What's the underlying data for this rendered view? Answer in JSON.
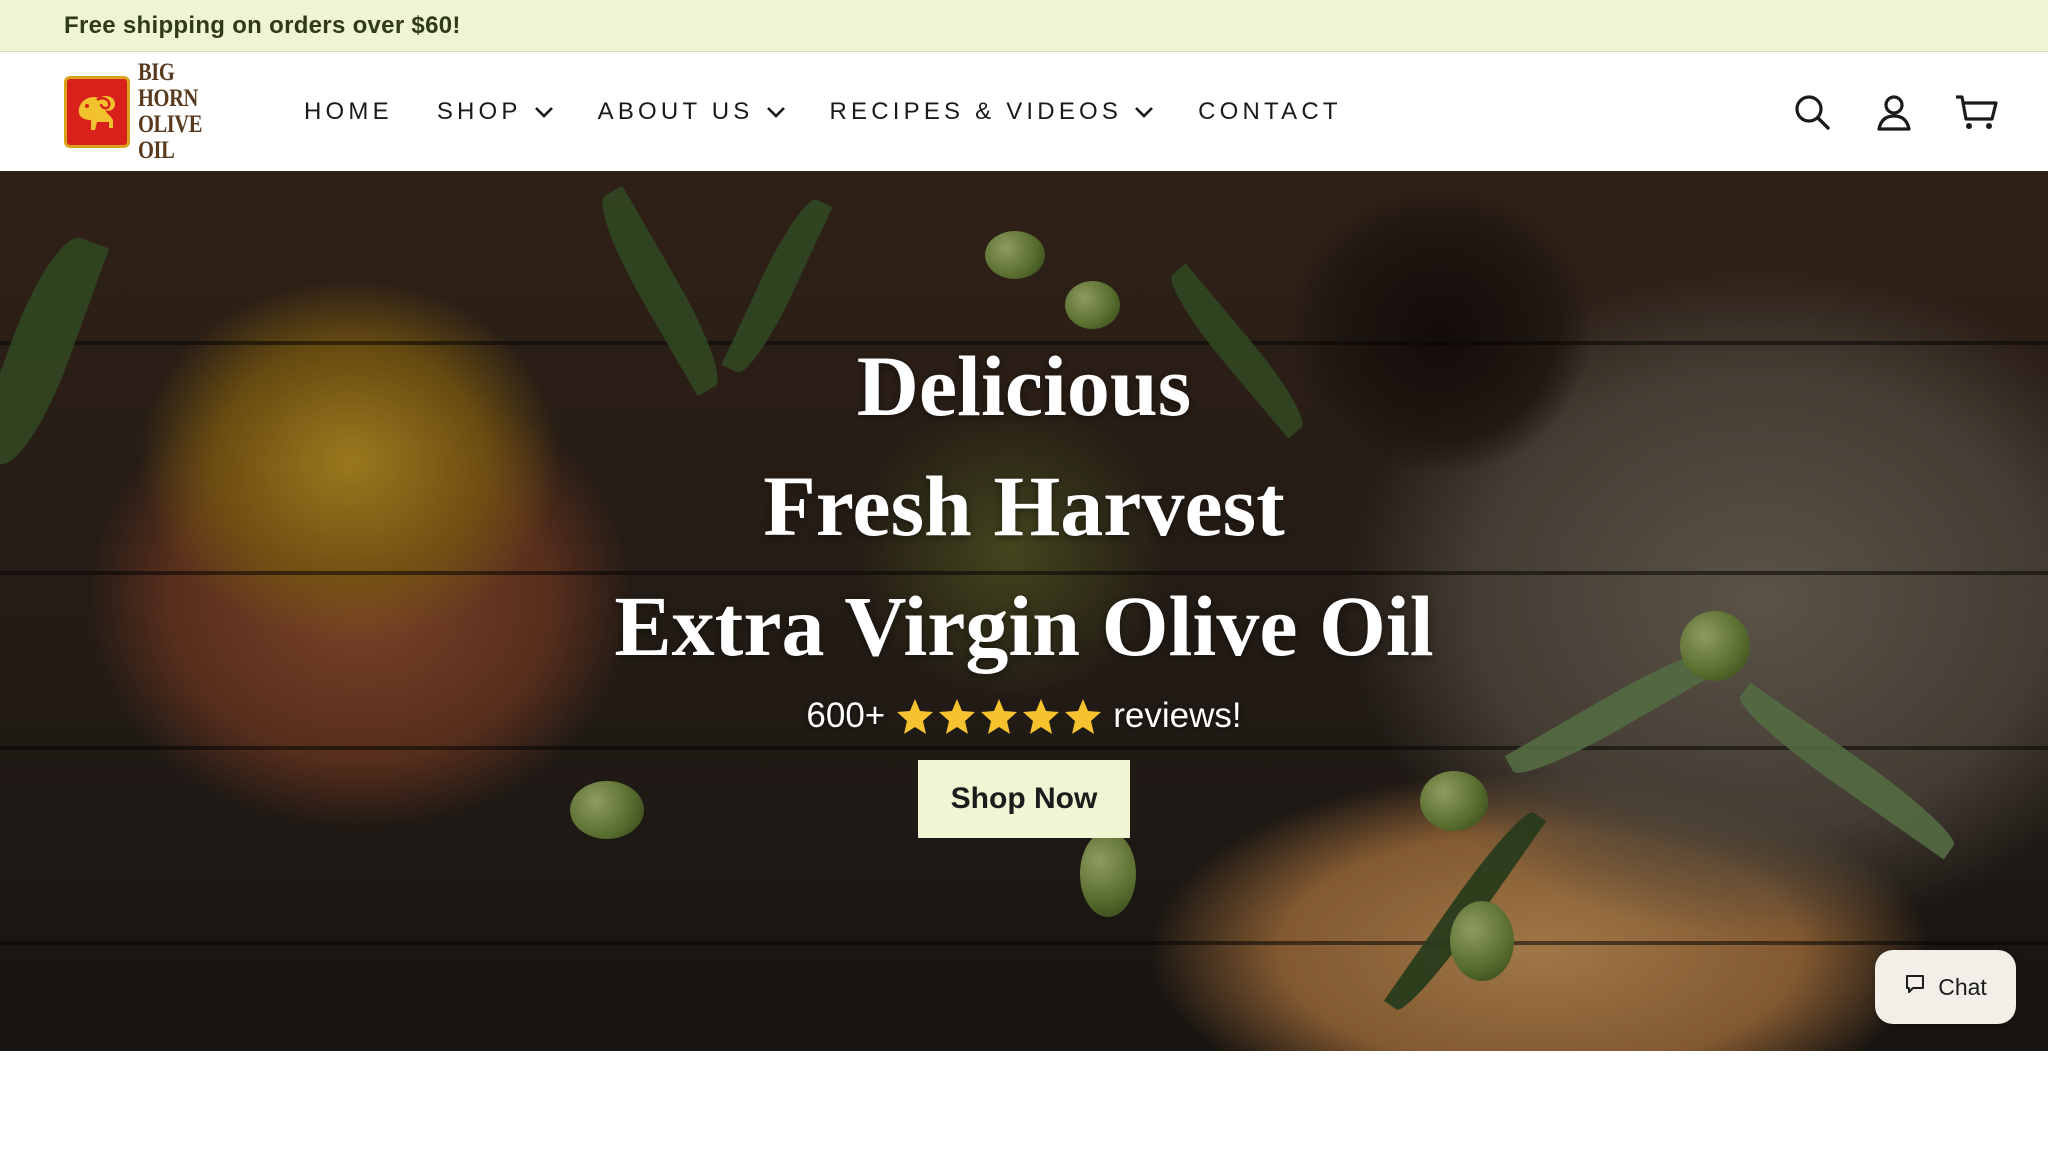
{
  "announcement": {
    "text": "Free shipping on orders over $60!"
  },
  "brand": {
    "name_line1": "BIG HORN",
    "name_line2": "OLIVE OIL",
    "logo_icon": "ram-icon",
    "colors": {
      "badge_red": "#d9211b",
      "badge_gold": "#d8a21c",
      "text_brown": "#5a3a1e"
    }
  },
  "nav": {
    "items": [
      {
        "label": "HOME",
        "has_dropdown": false
      },
      {
        "label": "SHOP",
        "has_dropdown": true
      },
      {
        "label": "ABOUT US",
        "has_dropdown": true
      },
      {
        "label": "RECIPES & VIDEOS",
        "has_dropdown": true
      },
      {
        "label": "CONTACT",
        "has_dropdown": false
      }
    ]
  },
  "header_icons": [
    "search-icon",
    "account-icon",
    "cart-icon"
  ],
  "hero": {
    "headline_lines": [
      "Delicious",
      "Fresh Harvest",
      "Extra Virgin Olive Oil"
    ],
    "reviews_count": "600+",
    "rating_stars": 5,
    "reviews_suffix": "reviews!",
    "cta_label": "Shop Now"
  },
  "chat": {
    "label": "Chat",
    "icon": "chat-bubble-icon"
  },
  "colors": {
    "announcement_bg": "#eff4d4",
    "announcement_text": "#2f3a16",
    "cta_bg": "#f0f5d3",
    "star": "#f6c22e"
  }
}
